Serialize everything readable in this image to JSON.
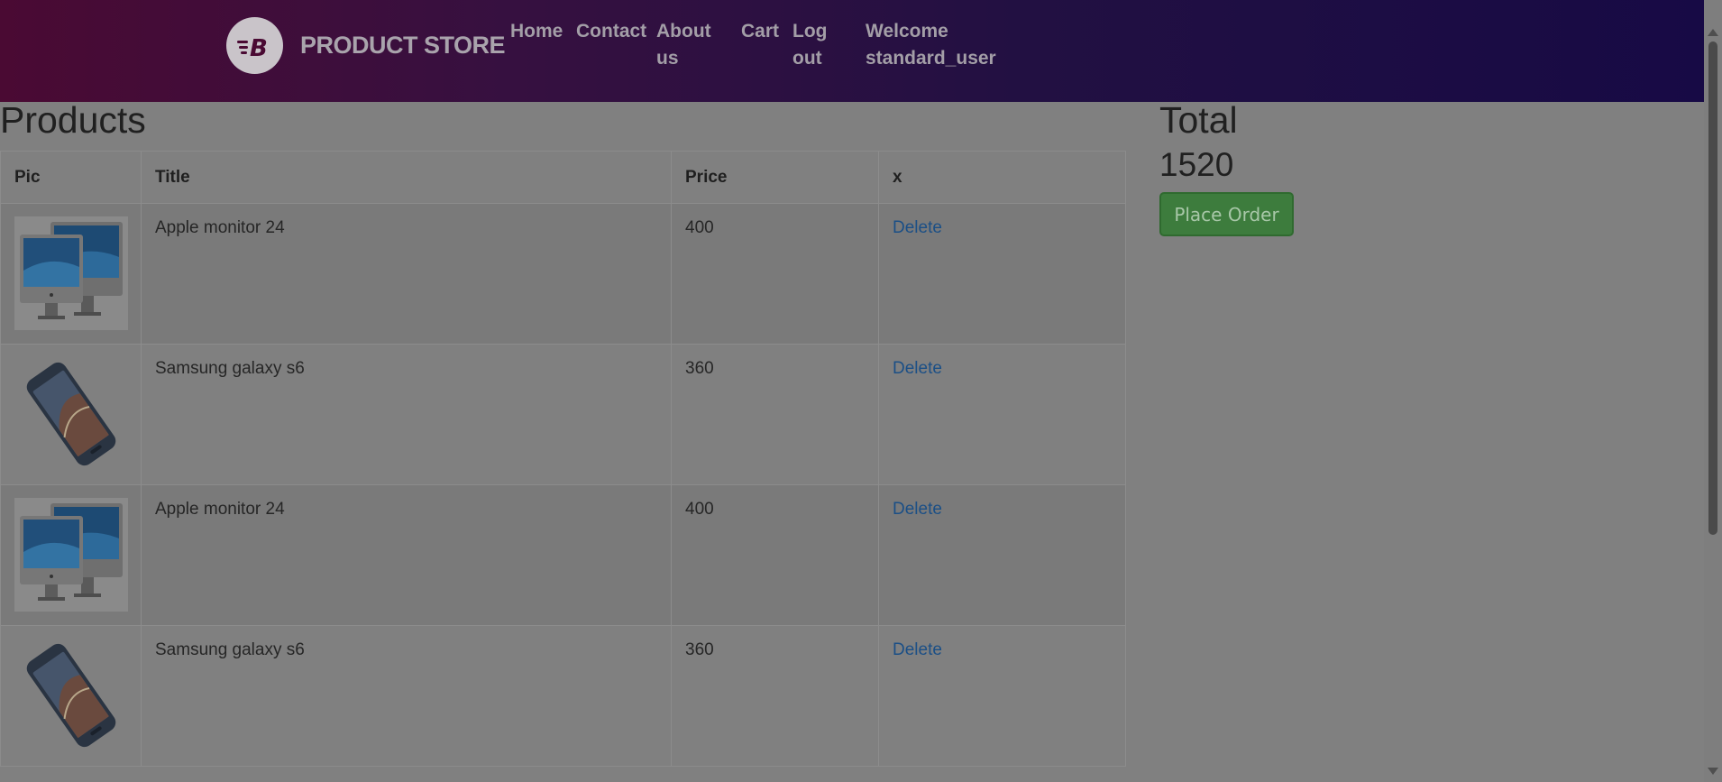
{
  "navbar": {
    "brand_name": "PRODUCT STORE",
    "links": {
      "home": "Home",
      "contact": "Contact",
      "about_line1": "About",
      "about_line2": "us",
      "cart": "Cart",
      "logout_line1": "Log",
      "logout_line2": "out",
      "welcome_line1": "Welcome",
      "welcome_line2": "standard_user"
    }
  },
  "products": {
    "title": "Products",
    "columns": [
      "Pic",
      "Title",
      "Price",
      "x"
    ],
    "rows": [
      {
        "title": "Apple monitor 24",
        "price": "400",
        "action": "Delete",
        "image": "apple-monitor-icon"
      },
      {
        "title": "Samsung galaxy s6",
        "price": "360",
        "action": "Delete",
        "image": "samsung-phone-icon"
      },
      {
        "title": "Apple monitor 24",
        "price": "400",
        "action": "Delete",
        "image": "apple-monitor-icon"
      },
      {
        "title": "Samsung galaxy s6",
        "price": "360",
        "action": "Delete",
        "image": "samsung-phone-icon"
      }
    ]
  },
  "total": {
    "label": "Total",
    "value": "1520",
    "place_order_label": "Place Order"
  },
  "colors": {
    "navbar_start": "#4a0a33",
    "navbar_end": "#170a45",
    "place_order_bg": "#3d7c3d",
    "link": "#1b4f86"
  }
}
